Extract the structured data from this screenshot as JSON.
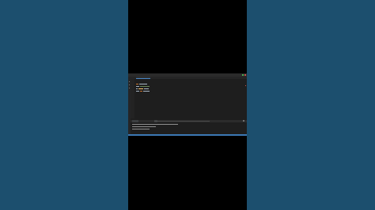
{
  "window": {
    "title": ""
  },
  "editor": {
    "lines": [
      {
        "kind": "blank"
      },
      {
        "kind": "code",
        "parts": [
          [
            "kw",
            3
          ],
          [
            "tx",
            10
          ]
        ]
      },
      {
        "kind": "code",
        "parts": [
          [
            "tx",
            4
          ],
          [
            "cm",
            12
          ]
        ]
      },
      {
        "kind": "code",
        "parts": [
          [
            "tx",
            2
          ],
          [
            "fn",
            6
          ],
          [
            "tx",
            6
          ]
        ]
      },
      {
        "kind": "code",
        "parts": [
          [
            "tx",
            4
          ],
          [
            "kw",
            3
          ],
          [
            "tx",
            8
          ]
        ]
      }
    ]
  },
  "panel": {
    "tabs": [
      "",
      "",
      "",
      ""
    ]
  },
  "terminal": {
    "lines": [
      58,
      30,
      22
    ]
  },
  "status": {
    "left": "",
    "right": ""
  },
  "colors": {
    "background": "#1c4f6e",
    "editor_bg": "#1e1e1e",
    "status_bar": "#3c78b4",
    "keyword": "#cc7832",
    "function": "#ffc66d",
    "comment": "#6a8759",
    "run_button": "#4caf50",
    "stop_button": "#c75450"
  }
}
